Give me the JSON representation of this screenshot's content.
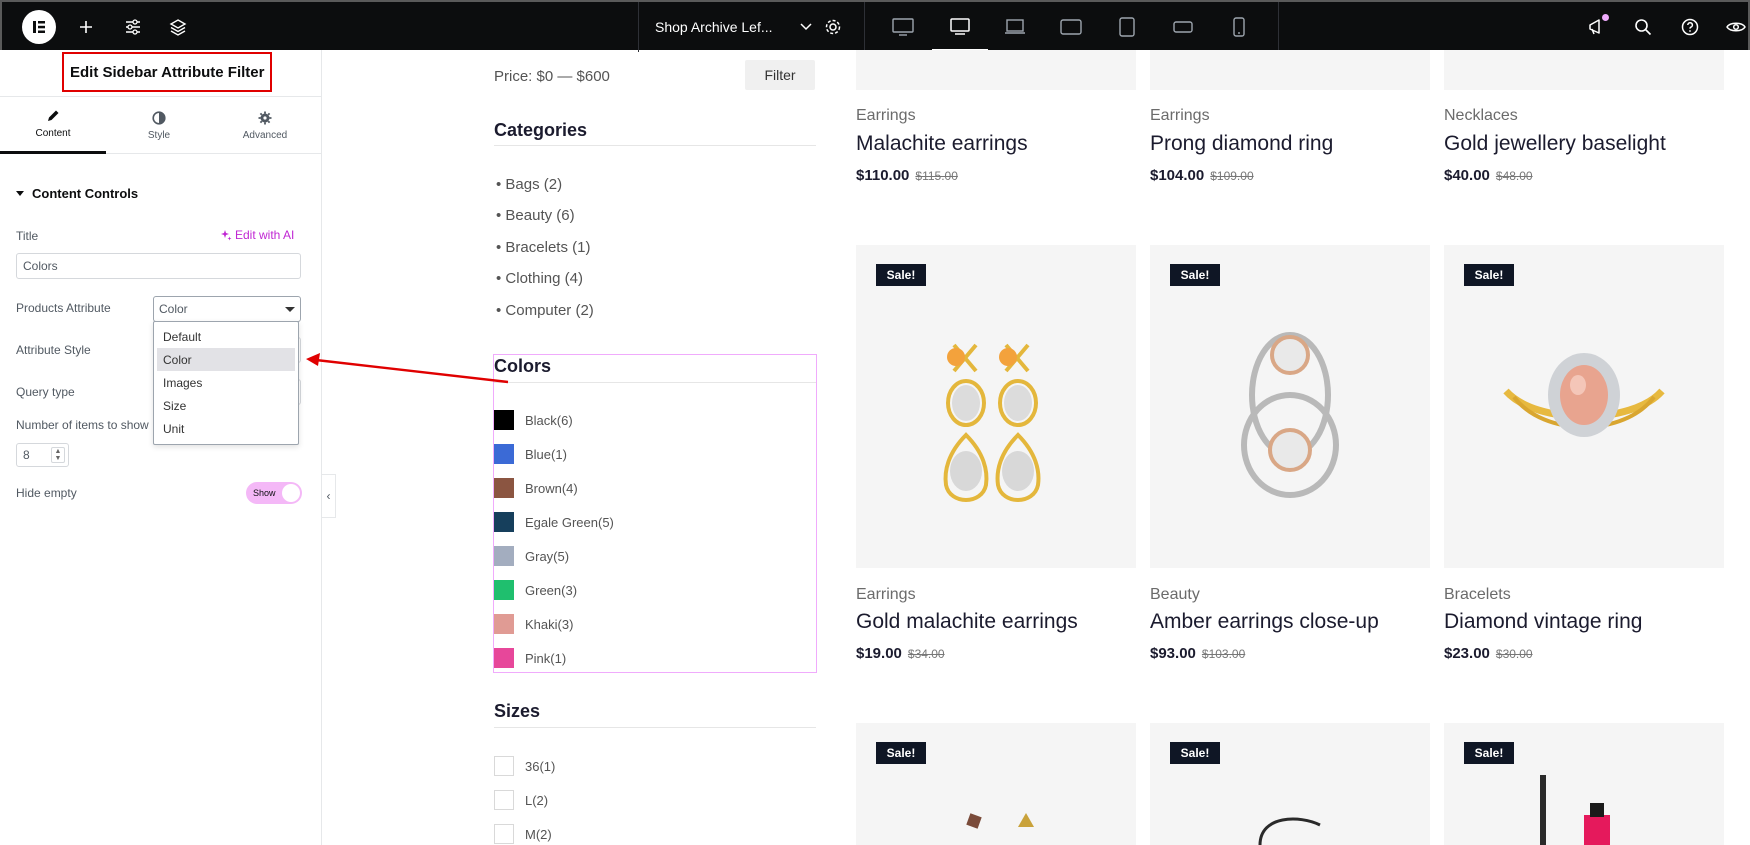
{
  "topbar": {
    "page_name": "Shop Archive Lef...",
    "colors": {
      "bg": "#0c0d0e",
      "badge": "#f0abfc"
    }
  },
  "panel": {
    "title": "Edit Sidebar Attribute Filter",
    "tabs": [
      {
        "label": "Content",
        "icon": "pencil-icon"
      },
      {
        "label": "Style",
        "icon": "half-circle-icon"
      },
      {
        "label": "Advanced",
        "icon": "gear-icon"
      }
    ],
    "section": "Content Controls",
    "title_label": "Title",
    "ai_link": "Edit with AI",
    "title_value": "Colors",
    "products_attribute_label": "Products Attribute",
    "products_attribute_value": "Color",
    "attribute_style_label": "Attribute Style",
    "query_type_label": "Query type",
    "items_label": "Number of items to show",
    "items_value": "8",
    "hide_empty_label": "Hide empty",
    "hide_empty_toggle": "Show",
    "dropdown_options": [
      "Default",
      "Color",
      "Images",
      "Size",
      "Unit"
    ],
    "dropdown_selected": "Color",
    "accent": "#c026d3"
  },
  "filters": {
    "price": "Price: $0 — $600",
    "filter_button": "Filter",
    "categories_title": "Categories",
    "categories": [
      "Bags (2)",
      "Beauty (6)",
      "Bracelets (1)",
      "Clothing (4)",
      "Computer (2)"
    ],
    "colors_title": "Colors",
    "colors": [
      {
        "label": "Black(6)",
        "hex": "#000000"
      },
      {
        "label": "Blue(1)",
        "hex": "#3b6ad6"
      },
      {
        "label": "Brown(4)",
        "hex": "#8b5541"
      },
      {
        "label": "Egale Green(5)",
        "hex": "#163f5c"
      },
      {
        "label": "Gray(5)",
        "hex": "#a3adbf"
      },
      {
        "label": "Green(3)",
        "hex": "#1fbf6e"
      },
      {
        "label": "Khaki(3)",
        "hex": "#e09b94"
      },
      {
        "label": "Pink(1)",
        "hex": "#e7479a"
      }
    ],
    "sizes_title": "Sizes",
    "sizes": [
      "36(1)",
      "L(2)",
      "M(2)"
    ]
  },
  "products": {
    "sale_badge": "Sale!",
    "row1": [
      {
        "category": "Earrings",
        "name": "Malachite earrings",
        "price": "$110.00",
        "old_price": "$115.00"
      },
      {
        "category": "Earrings",
        "name": "Prong diamond ring",
        "price": "$104.00",
        "old_price": "$109.00"
      },
      {
        "category": "Necklaces",
        "name": "Gold jewellery baselight",
        "price": "$40.00",
        "old_price": "$48.00"
      }
    ],
    "row2": [
      {
        "category": "Earrings",
        "name": "Gold malachite earrings",
        "price": "$19.00",
        "old_price": "$34.00"
      },
      {
        "category": "Beauty",
        "name": "Amber earrings close-up",
        "price": "$93.00",
        "old_price": "$103.00"
      },
      {
        "category": "Bracelets",
        "name": "Diamond vintage ring",
        "price": "$23.00",
        "old_price": "$30.00"
      }
    ]
  }
}
